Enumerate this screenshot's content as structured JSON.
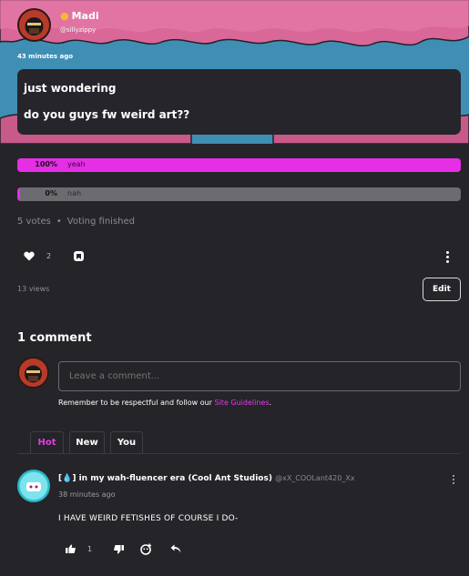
{
  "post": {
    "author_name": "Madi",
    "author_handle": "@sillyzippy",
    "timestamp": "43 minutes ago",
    "lines": [
      "just wondering",
      "do you guys fw weird art??"
    ]
  },
  "poll": {
    "options": [
      {
        "label": "yeah",
        "percent": 100,
        "percent_text": "100%"
      },
      {
        "label": "nah",
        "percent": 0,
        "percent_text": "0%"
      }
    ],
    "votes_text": "5 votes",
    "status": "Voting finished"
  },
  "actions": {
    "like_count": "2",
    "views": "13 views",
    "edit_label": "Edit"
  },
  "comments": {
    "title": "1 comment",
    "input_placeholder": "Leave a comment...",
    "guidelines_text": "Remember to be respectful and follow our ",
    "guidelines_link": "Site Guidelines",
    "guidelines_end": ".",
    "tabs": [
      "Hot",
      "New",
      "You"
    ],
    "items": [
      {
        "author": "[💧] in my wah-fluencer era (Cool Ant Studios)",
        "handle": "@xX_COOLant420_Xx",
        "time": "38 minutes ago",
        "body": "I HAVE WEIRD FETISHES OF COURSE I DO-",
        "like_count": "1"
      }
    ]
  },
  "colors": {
    "accent": "#e23be6",
    "background": "#252429",
    "banner_sky": "#3f8fb4",
    "banner_cloud": "#e2709f"
  },
  "icons": [
    "heart-icon",
    "bookmark-icon",
    "kebab-menu-icon",
    "thumb-up-icon",
    "thumb-down-icon",
    "add-reaction-icon",
    "reply-icon"
  ]
}
